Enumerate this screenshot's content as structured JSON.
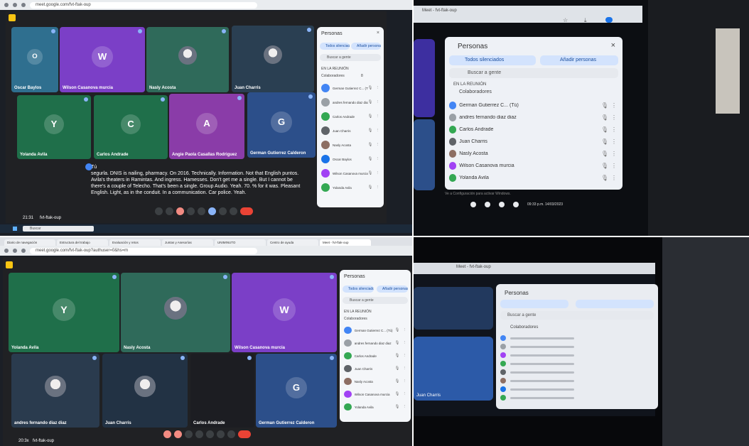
{
  "panel1": {
    "url": "meet.google.com/fvt-ftak-oup",
    "tiles": [
      {
        "name": "Oscar Baylos",
        "initial": "O",
        "color": "#2f6f8f"
      },
      {
        "name": "Wilson Casanova murcia",
        "initial": "W",
        "color": "#7b3fc7"
      },
      {
        "name": "Nasly Acosta",
        "initial": "",
        "color": "#2f6a5a"
      },
      {
        "name": "Juan Charris",
        "initial": "",
        "color": "#2a3f52"
      },
      {
        "name": "Yolanda Avila",
        "initial": "Y",
        "color": "#1f6f4a"
      },
      {
        "name": "Carlos Andrade",
        "initial": "C",
        "color": "#1f6f4a"
      },
      {
        "name": "Angie Paola Casallas Rodriguez",
        "initial": "A",
        "color": "#8a3ca8"
      },
      {
        "name": "German Gutierrez Calderon",
        "initial": "G",
        "color": "#2c4f8a"
      }
    ],
    "people_panel": {
      "title": "Personas",
      "mute_all": "Todos silenciados",
      "add_people": "Añadir personas",
      "search": "Buscar a gente",
      "in_meeting": "EN LA REUNIÓN",
      "group": "Colaboradores",
      "count": "8"
    },
    "participants": [
      {
        "name": "German Gutierrez C... (Tú)",
        "color": "#4285f4"
      },
      {
        "name": "andres fernando diaz diaz",
        "color": "#9aa0a6"
      },
      {
        "name": "Carlos Andrade",
        "color": "#34a853"
      },
      {
        "name": "Juan Charris",
        "color": "#5f6368"
      },
      {
        "name": "Nasly Acosta",
        "color": "#8d6e63"
      },
      {
        "name": "Oscar Baylos",
        "color": "#1a73e8"
      },
      {
        "name": "Wilson Casanova murcia",
        "color": "#a142f4"
      },
      {
        "name": "Yolanda Avila",
        "color": "#34a853"
      }
    ],
    "caption_speaker": "Tú",
    "caption": "segurla. DNIS is nailing, pharmacy. On 2016. Technically. Information. Not that English puntos. Avila's theaters in Ramintas. And ingress. Hamesses. Don't get me a single. But I cannot be there's a couple of Telecho. That's been a single. Group Audio. Yeah. 70. % for it was. Pleasant English. Light, as in the conduit. In a communication. Car police. Yeah.",
    "meeting_time": "21:31",
    "meeting_code": "fvt-ftak-oup",
    "taskbar_search": "Buscar"
  },
  "panel2": {
    "tab": "Meet - fvt-ftak-oup",
    "title": "Personas",
    "mute_all": "Todos silenciados",
    "add_people": "Añadir personas",
    "search": "Buscar a gente",
    "in_meeting": "EN LA REUNIÓN",
    "group": "Colaboradores",
    "participants": [
      {
        "name": "German Gutierrez C... (Tú)",
        "color": "#4285f4"
      },
      {
        "name": "andres fernando diaz diaz",
        "color": "#9aa0a6"
      },
      {
        "name": "Carlos Andrade",
        "color": "#34a853"
      },
      {
        "name": "Juan Charris",
        "color": "#5f6368"
      },
      {
        "name": "Nasly Acosta",
        "color": "#8d6e63"
      },
      {
        "name": "Wilson Casanova murcia",
        "color": "#a142f4"
      },
      {
        "name": "Yolanda Avila",
        "color": "#34a853"
      }
    ],
    "windows_notice": "Ve a Configuración para activar Windows.",
    "clock": "09:33 p.m. 14/03/2023"
  },
  "panel3": {
    "tabs": [
      "Diario de navegación",
      "Estructura del trabajo",
      "Evaluación y retos",
      "Juntas y Asesorías",
      "UNIMINUTO",
      "Centro de ayuda",
      "Meet - fvt-ftak-oup"
    ],
    "url": "meet.google.com/fvt-ftak-oup?authuser=0&hs=m",
    "tiles": [
      {
        "name": "Yolanda Avila",
        "initial": "Y",
        "color": "#1f6f4a"
      },
      {
        "name": "Nasly Acosta",
        "initial": "",
        "color": "#2f6a5a"
      },
      {
        "name": "Wilson Casanova murcia",
        "initial": "W",
        "color": "#7b3fc7"
      },
      {
        "name": "andres fernando diaz diaz",
        "initial": "",
        "color": "#2a3b4e"
      },
      {
        "name": "Juan Charris",
        "initial": "",
        "color": "#223244"
      },
      {
        "name": "Carlos Andrade",
        "initial": "",
        "color": "#1c1d22"
      },
      {
        "name": "German Gutierrez Calderon",
        "initial": "G",
        "color": "#2c4f8a"
      }
    ],
    "people_title": "Personas",
    "mute_all": "Todos silenciados",
    "add_people": "Añadir personas",
    "search": "Buscar a gente",
    "in_meeting": "EN LA REUNIÓN",
    "group": "Colaboradores",
    "participants": [
      {
        "name": "German Gutierrez C... (Tú)",
        "color": "#4285f4"
      },
      {
        "name": "andres fernando diaz diaz",
        "color": "#9aa0a6"
      },
      {
        "name": "Carlos Andrade",
        "color": "#34a853"
      },
      {
        "name": "Juan Charris",
        "color": "#5f6368"
      },
      {
        "name": "Nasly Acosta",
        "color": "#8d6e63"
      },
      {
        "name": "Wilson Casanova murcia",
        "color": "#a142f4"
      },
      {
        "name": "Yolanda Avila",
        "color": "#34a853"
      }
    ],
    "meeting_time": "20:3x",
    "meeting_code": "fvt-ftak-oup"
  },
  "panel4": {
    "tab": "Meet - fvt-ftak-oup",
    "title": "Personas",
    "search": "Buscar a gente",
    "group": "Colaboradores",
    "tile_name": "Juan Charris",
    "participant_colors": [
      "#4285f4",
      "#9aa0a6",
      "#a142f4",
      "#34a853",
      "#5f6368",
      "#8d6e63",
      "#1a73e8",
      "#34a853"
    ]
  }
}
